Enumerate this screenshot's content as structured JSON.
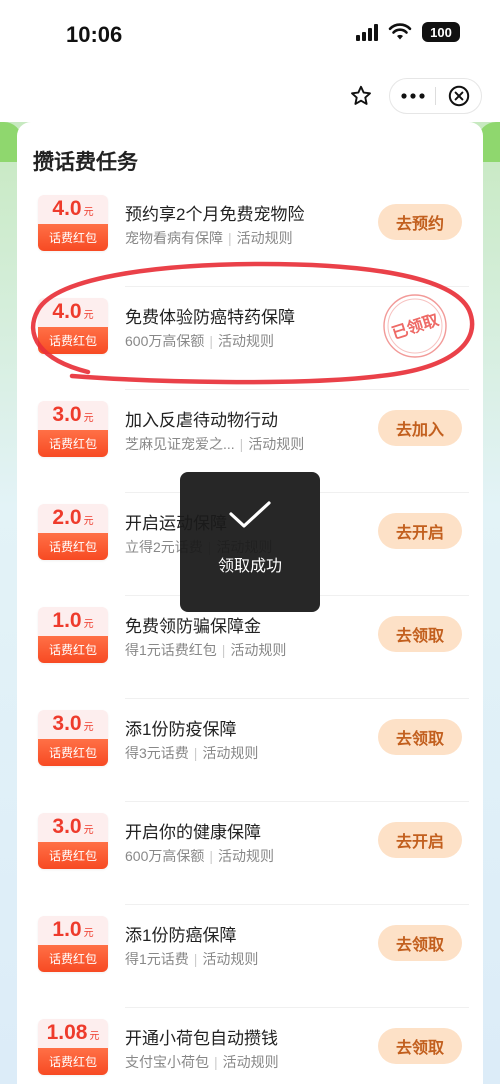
{
  "status_bar": {
    "time": "10:06",
    "battery": "100"
  },
  "nav": {
    "star_icon": "star-icon",
    "more_icon": "more-icon",
    "close_icon": "close-circle-icon"
  },
  "section": {
    "title": "攒话费任务"
  },
  "tasks": [
    {
      "amount": "4.0",
      "unit": "元",
      "coupon_label": "话费红包",
      "title": "预约享2个月免费宠物险",
      "desc": "宠物看病有保障",
      "rules": "活动规则",
      "action": "去预约"
    },
    {
      "amount": "4.0",
      "unit": "元",
      "coupon_label": "话费红包",
      "title": "免费体验防癌特药保障",
      "desc": "600万高保额",
      "rules": "活动规则",
      "action": "已领取"
    },
    {
      "amount": "3.0",
      "unit": "元",
      "coupon_label": "话费红包",
      "title": "加入反虐待动物行动",
      "desc": "芝麻见证宠爱之...",
      "rules": "活动规则",
      "action": "去加入"
    },
    {
      "amount": "2.0",
      "unit": "元",
      "coupon_label": "话费红包",
      "title": "开启运动保障",
      "desc": "立得2元话费",
      "rules": "活动规则",
      "action": "去开启"
    },
    {
      "amount": "1.0",
      "unit": "元",
      "coupon_label": "话费红包",
      "title": "免费领防骗保障金",
      "desc": "得1元话费红包",
      "rules": "活动规则",
      "action": "去领取"
    },
    {
      "amount": "3.0",
      "unit": "元",
      "coupon_label": "话费红包",
      "title": "添1份防疫保障",
      "desc": "得3元话费",
      "rules": "活动规则",
      "action": "去领取"
    },
    {
      "amount": "3.0",
      "unit": "元",
      "coupon_label": "话费红包",
      "title": "开启你的健康保障",
      "desc": "600万高保额",
      "rules": "活动规则",
      "action": "去开启"
    },
    {
      "amount": "1.0",
      "unit": "元",
      "coupon_label": "话费红包",
      "title": "添1份防癌保障",
      "desc": "得1元话费",
      "rules": "活动规则",
      "action": "去领取"
    },
    {
      "amount": "1.08",
      "unit": "元",
      "coupon_label": "话费红包",
      "title": "开通小荷包自动攒钱",
      "desc": "支付宝小荷包",
      "rules": "活动规则",
      "action": "去领取"
    }
  ],
  "toast": {
    "message": "领取成功"
  },
  "colors": {
    "accent_red": "#ee3b2c",
    "button_bg": "#fde1c7",
    "button_text": "#c25f1e",
    "annotation": "#e8313a"
  }
}
